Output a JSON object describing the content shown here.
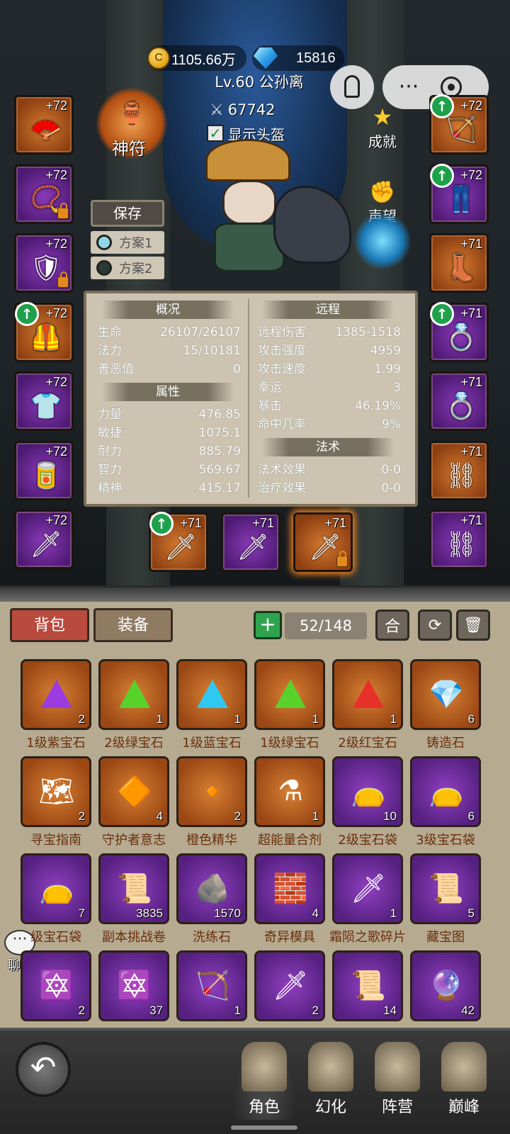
{
  "header": {
    "gold": "1105.66万",
    "gems": "15816",
    "player": "Lv.60 公孙离",
    "power": "67742",
    "helmet_toggle": "显示头盔"
  },
  "side_buttons": {
    "talisman": "神符",
    "achievement": "成就",
    "reputation": "声望",
    "save": "保存",
    "plan1": "方案1",
    "plan2": "方案2"
  },
  "left_slots": [
    {
      "lvl": "+72",
      "icon": "fan-icon"
    },
    {
      "lvl": "+72",
      "icon": "bead-necklace-icon"
    },
    {
      "lvl": "+72",
      "icon": "shoulder-icon"
    },
    {
      "lvl": "+72",
      "icon": "chest-armor-icon"
    },
    {
      "lvl": "+72",
      "icon": "shirt-icon"
    },
    {
      "lvl": "+72",
      "icon": "bracer-icon"
    },
    {
      "lvl": "+72",
      "icon": "dagger-icon"
    }
  ],
  "right_slots": [
    {
      "lvl": "+72",
      "icon": "crossbow-icon"
    },
    {
      "lvl": "+72",
      "icon": "pants-icon"
    },
    {
      "lvl": "+71",
      "icon": "boots-icon"
    },
    {
      "lvl": "+71",
      "icon": "ring-icon"
    },
    {
      "lvl": "+71",
      "icon": "ring-icon"
    },
    {
      "lvl": "+71",
      "icon": "belt-icon"
    },
    {
      "lvl": "+71",
      "icon": "belt-icon"
    }
  ],
  "weapon_slots": [
    {
      "lvl": "+71"
    },
    {
      "lvl": "+71"
    },
    {
      "lvl": "+71"
    }
  ],
  "stats": {
    "overview_title": "概况",
    "attr_title": "属性",
    "ranged_title": "远程",
    "spell_title": "法术",
    "overview": [
      {
        "k": "生命",
        "v": "26107/26107"
      },
      {
        "k": "法力",
        "v": "15/10181"
      },
      {
        "k": "善恶值",
        "v": "0"
      }
    ],
    "attributes": [
      {
        "k": "力量",
        "v": "476.85"
      },
      {
        "k": "敏捷",
        "v": "1075.1"
      },
      {
        "k": "耐力",
        "v": "885.79"
      },
      {
        "k": "智力",
        "v": "569.67"
      },
      {
        "k": "精神",
        "v": "415.17"
      }
    ],
    "ranged": [
      {
        "k": "远程伤害",
        "v": "1385-1518"
      },
      {
        "k": "攻击强度",
        "v": "4959"
      },
      {
        "k": "攻击速度",
        "v": "1.99"
      },
      {
        "k": "幸运",
        "v": "3"
      },
      {
        "k": "暴击",
        "v": "46.19%"
      },
      {
        "k": "命中几率",
        "v": "9%"
      }
    ],
    "spell": [
      {
        "k": "法术效果",
        "v": "0-0"
      },
      {
        "k": "治疗效果",
        "v": "0-0"
      }
    ]
  },
  "inventory": {
    "tab_bag": "背包",
    "tab_equip": "装备",
    "capacity": "52/148",
    "add": "+",
    "merge": "合",
    "items": [
      {
        "name": "1级紫宝石",
        "count": "2",
        "color": "orange",
        "icon": "purple-gem-icon"
      },
      {
        "name": "2级绿宝石",
        "count": "1",
        "color": "orange",
        "icon": "green-gem-icon"
      },
      {
        "name": "1级蓝宝石",
        "count": "1",
        "color": "orange",
        "icon": "blue-gem-icon"
      },
      {
        "name": "1级绿宝石",
        "count": "1",
        "color": "orange",
        "icon": "green-gem-icon"
      },
      {
        "name": "2级红宝石",
        "count": "1",
        "color": "orange",
        "icon": "red-gem-icon"
      },
      {
        "name": "铸造石",
        "count": "6",
        "color": "orange",
        "icon": "forge-stone-icon"
      },
      {
        "name": "寻宝指南",
        "count": "2",
        "color": "orange",
        "icon": "treasure-map-icon"
      },
      {
        "name": "守护者意志",
        "count": "4",
        "color": "orange",
        "icon": "orb-icon"
      },
      {
        "name": "橙色精华",
        "count": "2",
        "color": "orange",
        "icon": "essence-icon"
      },
      {
        "name": "超能量合剂",
        "count": "1",
        "color": "orange",
        "icon": "potion-icon"
      },
      {
        "name": "2级宝石袋",
        "count": "10",
        "color": "purple",
        "icon": "gem-bag-icon"
      },
      {
        "name": "3级宝石袋",
        "count": "6",
        "color": "purple",
        "icon": "gem-bag-icon"
      },
      {
        "name": "级宝石袋",
        "count": "7",
        "color": "purple",
        "icon": "gem-bag-icon"
      },
      {
        "name": "副本挑战卷",
        "count": "3835",
        "color": "purple",
        "icon": "scroll-icon"
      },
      {
        "name": "洗练石",
        "count": "1570",
        "color": "purple",
        "icon": "rune-stone-icon"
      },
      {
        "name": "奇异模具",
        "count": "4",
        "color": "purple",
        "icon": "mold-icon"
      },
      {
        "name": "霜陨之歌碎片",
        "count": "1",
        "color": "purple",
        "icon": "sword-shard-icon"
      },
      {
        "name": "藏宝图",
        "count": "5",
        "color": "purple",
        "icon": "map-scroll-icon"
      },
      {
        "name": "",
        "count": "2",
        "color": "purple",
        "icon": "amulet-icon"
      },
      {
        "name": "",
        "count": "37",
        "color": "purple",
        "icon": "amulet-icon"
      },
      {
        "name": "",
        "count": "1",
        "color": "purple",
        "icon": "bow-icon"
      },
      {
        "name": "",
        "count": "2",
        "color": "purple",
        "icon": "dagger-icon"
      },
      {
        "name": "",
        "count": "14",
        "color": "purple",
        "icon": "scroll-icon"
      },
      {
        "name": "",
        "count": "42",
        "color": "purple",
        "icon": "amethyst-icon"
      }
    ]
  },
  "chat": "聊天",
  "nav": [
    {
      "label": "角色"
    },
    {
      "label": "幻化"
    },
    {
      "label": "阵营"
    },
    {
      "label": "巅峰"
    }
  ]
}
